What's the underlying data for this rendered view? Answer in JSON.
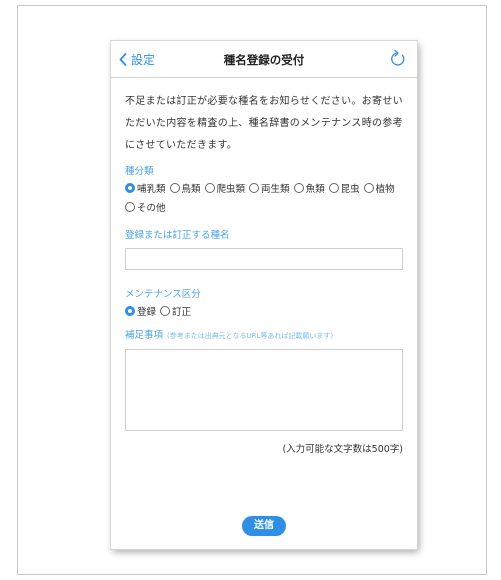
{
  "nav": {
    "back_label": "設定",
    "title": "種名登録の受付",
    "refresh_icon": "refresh-icon"
  },
  "intro_text": "不足または訂正が必要な種名をお知らせください。お寄せいただいた内容を精査の上、種名辞書のメンテナンス時の参考にさせていただきます。",
  "category": {
    "label": "種分類",
    "options": [
      "哺乳類",
      "鳥類",
      "爬虫類",
      "両生類",
      "魚類",
      "昆虫",
      "植物",
      "その他"
    ],
    "selected": "哺乳類"
  },
  "species_name": {
    "label": "登録または訂正する種名",
    "value": ""
  },
  "maintenance": {
    "label": "メンテナンス区分",
    "options": [
      "登録",
      "訂正"
    ],
    "selected": "登録"
  },
  "notes": {
    "label": "補足事項",
    "hint": "(参考または出典元となるURL等あれば記載願います)",
    "value": ""
  },
  "char_limit_note": "(入力可能な文字数は500字)",
  "submit_label": "送信",
  "colors": {
    "accent": "#2f8fe6",
    "label_blue": "#4aa3e8"
  }
}
